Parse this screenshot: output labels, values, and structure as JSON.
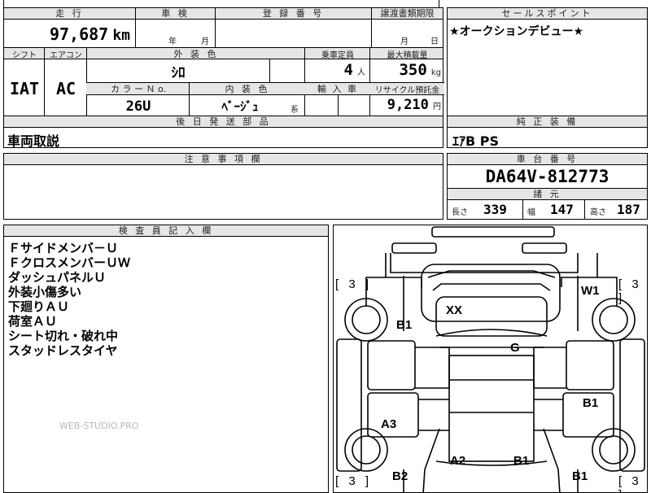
{
  "top": {
    "mileage_header": "走 行",
    "mileage_value": "97,687",
    "mileage_unit": "km",
    "inspection_header": "車 検",
    "inspection_year": "年",
    "inspection_month": "月",
    "registration_header": "登 録 番 号",
    "transfer_header": "譲渡書類期限",
    "transfer_month": "月",
    "transfer_day": "日",
    "sales_header": "セールスポイント",
    "sales_text": "★オークションデビュー★"
  },
  "row2": {
    "shift_header": "シフト",
    "ac_header": "エアコン",
    "exterior_header": "外 装 色",
    "capacity_header": "乗車定員",
    "load_header": "最大積載量",
    "shift_value": "IAT",
    "ac_value": "AC",
    "exterior_value": "ｼﾛ",
    "capacity_value": "4",
    "capacity_unit": "人",
    "load_value": "350",
    "load_unit": "kg",
    "color_no_header": "カ ラ ー Ｎ o.",
    "interior_header": "内 装 色",
    "import_header": "輸 入 車",
    "recycle_header": "リサイクル預託金",
    "color_no_value": "26U",
    "interior_value": "ﾍﾞｰｼﾞｭ",
    "interior_suffix": "系",
    "recycle_value": "9,210",
    "recycle_unit": "円"
  },
  "delivery": {
    "header": "後 日 発 送 部 品",
    "value": "車両取説"
  },
  "equipment": {
    "header": "純 正 装 備",
    "value": "ｴｱB PS"
  },
  "caution": {
    "header": "注 意 事 項 欄"
  },
  "chassis": {
    "header": "車 台 番 号",
    "value": "DA64V-812773",
    "spec_header": "諸 元",
    "length_label": "長さ",
    "length_value": "339",
    "width_label": "幅",
    "width_value": "147",
    "height_label": "高さ",
    "height_value": "187"
  },
  "inspector": {
    "header": "検 査 員 記 入 欄",
    "notes": [
      "Ｆサイドメンバ－Ｕ",
      "ＦクロスメンバーＵＷ",
      "ダッシュパネルＵ",
      "外装小傷多い",
      "下廻りＡＵ",
      "荷室ＡＵ",
      "シート切れ・破れ中",
      "スタッドレスタイヤ"
    ],
    "watermark": "WEB-STUDIO.PRO"
  },
  "diagram": {
    "tire_marks": [
      "[ 3 ]",
      "[ 3 ]",
      "[ 3 ]",
      "[ 3 ]"
    ],
    "damage": {
      "xx": "XX",
      "w1": "W1",
      "b1_left_front": "B1",
      "g": "G",
      "b1_right_mid": "B1",
      "a3": "A3",
      "a2": "A2",
      "b1_rear_center": "B1",
      "b2": "B2",
      "b1_right_rear": "B1"
    }
  }
}
